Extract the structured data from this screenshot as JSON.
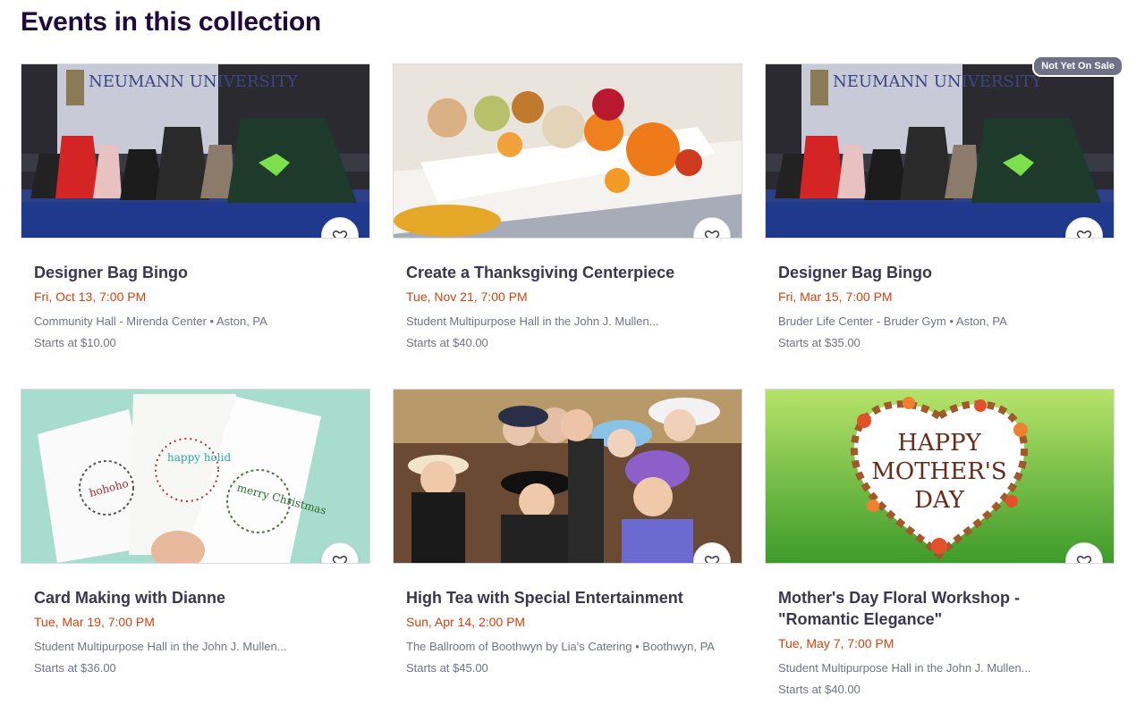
{
  "section": {
    "title": "Events in this collection"
  },
  "events": [
    {
      "title": "Designer Bag Bingo",
      "date": "Fri, Oct 13, 7:00 PM",
      "venue": "Community Hall - Mirenda Center • Aston, PA",
      "price": "Starts at $10.00"
    },
    {
      "title": "Create a Thanksgiving Centerpiece",
      "date": "Tue, Nov 21, 7:00 PM",
      "venue": "Student Multipurpose Hall in the John J. Mullen...",
      "price": "Starts at $40.00"
    },
    {
      "title": "Designer Bag Bingo",
      "date": "Fri, Mar 15, 7:00 PM",
      "venue": "Bruder Life Center - Bruder Gym • Aston, PA",
      "price": "Starts at $35.00",
      "badge": "Not Yet On Sale"
    },
    {
      "title": "Card Making with Dianne",
      "date": "Tue, Mar 19, 7:00 PM",
      "venue": "Student Multipurpose Hall in the John J. Mullen...",
      "price": "Starts at $36.00"
    },
    {
      "title": "High Tea with Special Entertainment",
      "date": "Sun, Apr 14, 2:00 PM",
      "venue": "The Ballroom of Boothwyn by Lia's Catering • Boothwyn, PA",
      "price": "Starts at $45.00"
    },
    {
      "title": "Mother's Day Floral Workshop - \"Romantic Elegance\"",
      "date": "Tue, May 7, 7:00 PM",
      "venue": "Student Multipurpose Hall in the John J. Mullen...",
      "price": "Starts at $40.00"
    }
  ],
  "images": {
    "bingo_screen_text": "NEUMANN UNIVERSITY",
    "card_texts": [
      "hohoho",
      "happy holid",
      "merry Christmas"
    ],
    "mothers_day_text": [
      "HAPPY",
      "MOTHER'S",
      "DAY"
    ]
  },
  "icons": {
    "favorite": "heart-icon"
  },
  "colors": {
    "title": "#1e0a3c",
    "date": "#d1410c",
    "meta": "#6f7287",
    "card_title": "#39364f"
  }
}
